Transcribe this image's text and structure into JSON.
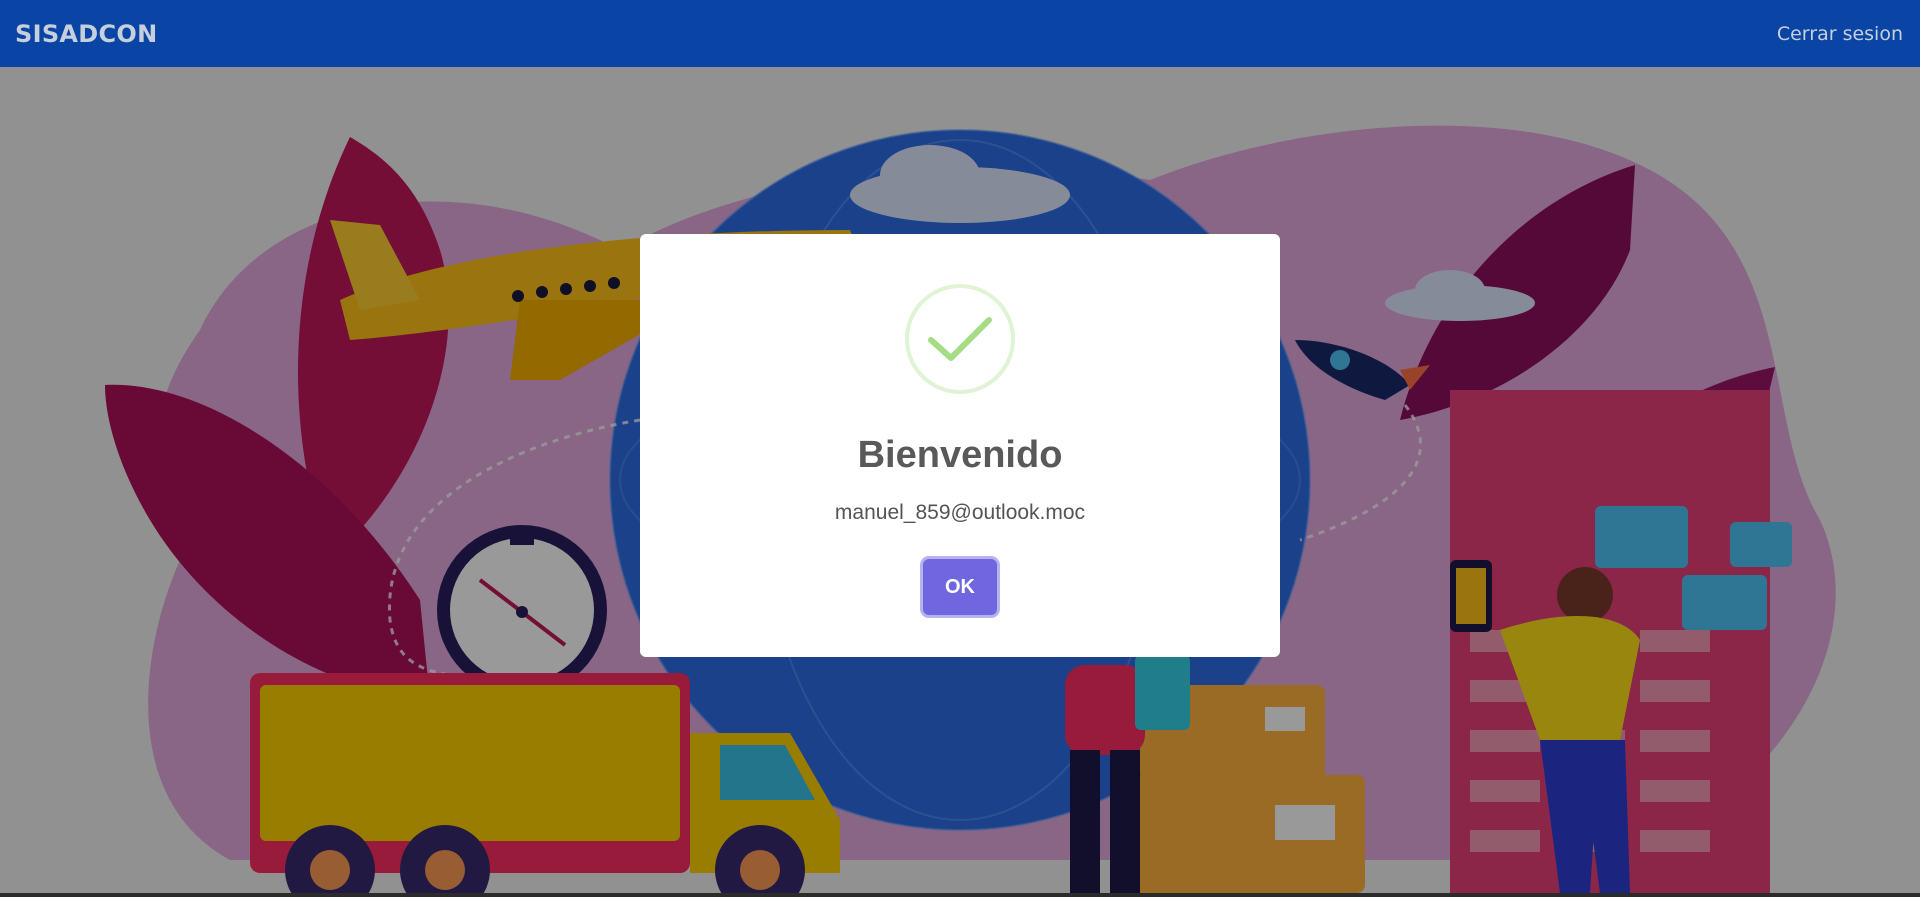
{
  "navbar": {
    "brand": "SISADCON",
    "logout_label": "Cerrar sesion"
  },
  "dialog": {
    "icon": "checkmark-icon",
    "title": "Bienvenido",
    "message": "manuel_859@outlook.moc",
    "ok_label": "OK"
  },
  "colors": {
    "navbar": "#0a45a5",
    "confirm_button": "#7066e0",
    "success_check": "#a5dc86"
  }
}
